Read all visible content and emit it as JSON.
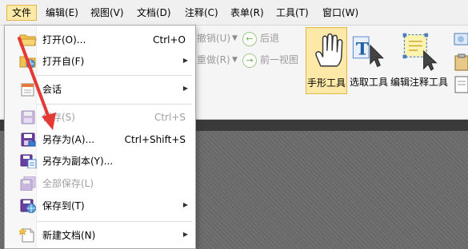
{
  "menubar": {
    "items": [
      {
        "label": "文件",
        "active": true
      },
      {
        "label": "编辑(E)"
      },
      {
        "label": "视图(V)"
      },
      {
        "label": "文档(D)"
      },
      {
        "label": "注释(C)"
      },
      {
        "label": "表单(R)"
      },
      {
        "label": "工具(T)"
      },
      {
        "label": "窗口(W)"
      }
    ]
  },
  "ribbon": {
    "undo": "撤销(U)",
    "back": "后退",
    "redo": "重做(R)",
    "forward": "前一视图",
    "hand_tool": "手形工具",
    "select_text": "选取工具",
    "edit_annotation": "编辑注释工具"
  },
  "file_menu": {
    "items": [
      {
        "label": "打开(O)...",
        "shortcut": "Ctrl+O",
        "disabled": false,
        "icon": "folder-open-icon"
      },
      {
        "label": "打开自(F)",
        "submenu": true,
        "disabled": false,
        "icon": "folder-web-icon"
      },
      {
        "label": "会话",
        "submenu": true,
        "disabled": false,
        "icon": "session-icon"
      },
      {
        "label": "保存(S)",
        "shortcut": "Ctrl+S",
        "disabled": true,
        "icon": "save-icon"
      },
      {
        "label": "另存为(A)...",
        "shortcut": "Ctrl+Shift+S",
        "disabled": false,
        "icon": "save-as-icon"
      },
      {
        "label": "另存为副本(Y)...",
        "disabled": false,
        "icon": "save-copy-icon"
      },
      {
        "label": "全部保存(L)",
        "disabled": true,
        "icon": "save-all-icon"
      },
      {
        "label": "保存到(T)",
        "submenu": true,
        "disabled": false,
        "icon": "save-to-icon"
      },
      {
        "label": "新建文档(N)",
        "submenu": true,
        "disabled": false,
        "icon": "new-document-icon"
      }
    ]
  },
  "colors": {
    "accent_highlight": "#fde9a7",
    "accent_border": "#e3b64a",
    "arrow": "#e53935",
    "disk": "#6a3fa0"
  }
}
